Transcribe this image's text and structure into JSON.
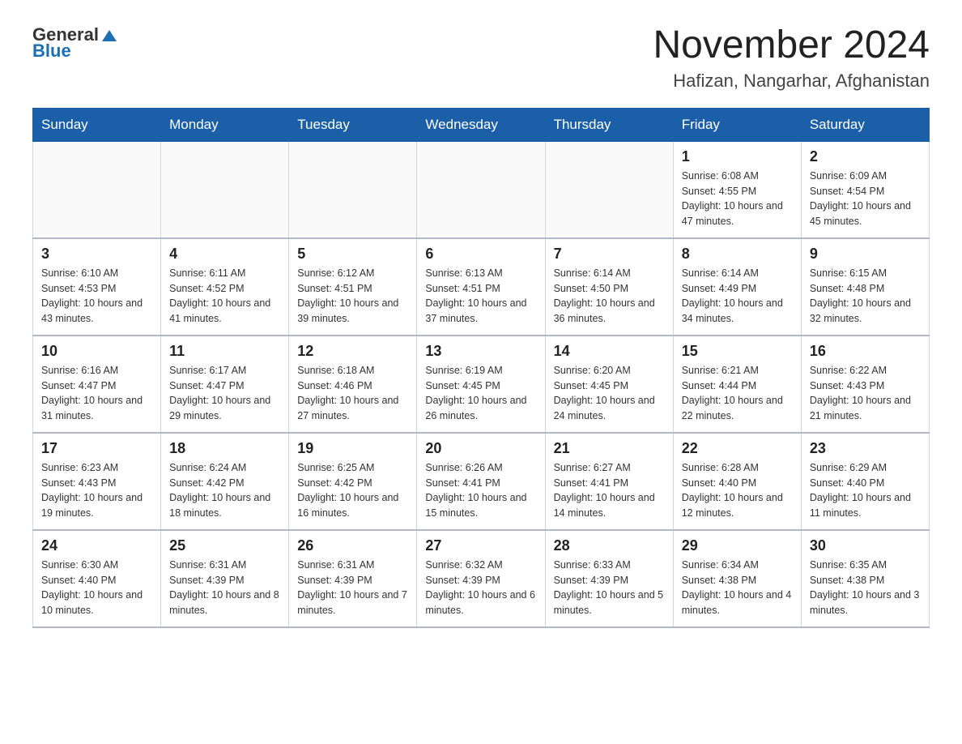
{
  "header": {
    "logo_general": "General",
    "logo_blue": "Blue",
    "title": "November 2024",
    "subtitle": "Hafizan, Nangarhar, Afghanistan"
  },
  "weekdays": [
    "Sunday",
    "Monday",
    "Tuesday",
    "Wednesday",
    "Thursday",
    "Friday",
    "Saturday"
  ],
  "weeks": [
    [
      {
        "day": "",
        "info": ""
      },
      {
        "day": "",
        "info": ""
      },
      {
        "day": "",
        "info": ""
      },
      {
        "day": "",
        "info": ""
      },
      {
        "day": "",
        "info": ""
      },
      {
        "day": "1",
        "info": "Sunrise: 6:08 AM\nSunset: 4:55 PM\nDaylight: 10 hours and 47 minutes."
      },
      {
        "day": "2",
        "info": "Sunrise: 6:09 AM\nSunset: 4:54 PM\nDaylight: 10 hours and 45 minutes."
      }
    ],
    [
      {
        "day": "3",
        "info": "Sunrise: 6:10 AM\nSunset: 4:53 PM\nDaylight: 10 hours and 43 minutes."
      },
      {
        "day": "4",
        "info": "Sunrise: 6:11 AM\nSunset: 4:52 PM\nDaylight: 10 hours and 41 minutes."
      },
      {
        "day": "5",
        "info": "Sunrise: 6:12 AM\nSunset: 4:51 PM\nDaylight: 10 hours and 39 minutes."
      },
      {
        "day": "6",
        "info": "Sunrise: 6:13 AM\nSunset: 4:51 PM\nDaylight: 10 hours and 37 minutes."
      },
      {
        "day": "7",
        "info": "Sunrise: 6:14 AM\nSunset: 4:50 PM\nDaylight: 10 hours and 36 minutes."
      },
      {
        "day": "8",
        "info": "Sunrise: 6:14 AM\nSunset: 4:49 PM\nDaylight: 10 hours and 34 minutes."
      },
      {
        "day": "9",
        "info": "Sunrise: 6:15 AM\nSunset: 4:48 PM\nDaylight: 10 hours and 32 minutes."
      }
    ],
    [
      {
        "day": "10",
        "info": "Sunrise: 6:16 AM\nSunset: 4:47 PM\nDaylight: 10 hours and 31 minutes."
      },
      {
        "day": "11",
        "info": "Sunrise: 6:17 AM\nSunset: 4:47 PM\nDaylight: 10 hours and 29 minutes."
      },
      {
        "day": "12",
        "info": "Sunrise: 6:18 AM\nSunset: 4:46 PM\nDaylight: 10 hours and 27 minutes."
      },
      {
        "day": "13",
        "info": "Sunrise: 6:19 AM\nSunset: 4:45 PM\nDaylight: 10 hours and 26 minutes."
      },
      {
        "day": "14",
        "info": "Sunrise: 6:20 AM\nSunset: 4:45 PM\nDaylight: 10 hours and 24 minutes."
      },
      {
        "day": "15",
        "info": "Sunrise: 6:21 AM\nSunset: 4:44 PM\nDaylight: 10 hours and 22 minutes."
      },
      {
        "day": "16",
        "info": "Sunrise: 6:22 AM\nSunset: 4:43 PM\nDaylight: 10 hours and 21 minutes."
      }
    ],
    [
      {
        "day": "17",
        "info": "Sunrise: 6:23 AM\nSunset: 4:43 PM\nDaylight: 10 hours and 19 minutes."
      },
      {
        "day": "18",
        "info": "Sunrise: 6:24 AM\nSunset: 4:42 PM\nDaylight: 10 hours and 18 minutes."
      },
      {
        "day": "19",
        "info": "Sunrise: 6:25 AM\nSunset: 4:42 PM\nDaylight: 10 hours and 16 minutes."
      },
      {
        "day": "20",
        "info": "Sunrise: 6:26 AM\nSunset: 4:41 PM\nDaylight: 10 hours and 15 minutes."
      },
      {
        "day": "21",
        "info": "Sunrise: 6:27 AM\nSunset: 4:41 PM\nDaylight: 10 hours and 14 minutes."
      },
      {
        "day": "22",
        "info": "Sunrise: 6:28 AM\nSunset: 4:40 PM\nDaylight: 10 hours and 12 minutes."
      },
      {
        "day": "23",
        "info": "Sunrise: 6:29 AM\nSunset: 4:40 PM\nDaylight: 10 hours and 11 minutes."
      }
    ],
    [
      {
        "day": "24",
        "info": "Sunrise: 6:30 AM\nSunset: 4:40 PM\nDaylight: 10 hours and 10 minutes."
      },
      {
        "day": "25",
        "info": "Sunrise: 6:31 AM\nSunset: 4:39 PM\nDaylight: 10 hours and 8 minutes."
      },
      {
        "day": "26",
        "info": "Sunrise: 6:31 AM\nSunset: 4:39 PM\nDaylight: 10 hours and 7 minutes."
      },
      {
        "day": "27",
        "info": "Sunrise: 6:32 AM\nSunset: 4:39 PM\nDaylight: 10 hours and 6 minutes."
      },
      {
        "day": "28",
        "info": "Sunrise: 6:33 AM\nSunset: 4:39 PM\nDaylight: 10 hours and 5 minutes."
      },
      {
        "day": "29",
        "info": "Sunrise: 6:34 AM\nSunset: 4:38 PM\nDaylight: 10 hours and 4 minutes."
      },
      {
        "day": "30",
        "info": "Sunrise: 6:35 AM\nSunset: 4:38 PM\nDaylight: 10 hours and 3 minutes."
      }
    ]
  ]
}
